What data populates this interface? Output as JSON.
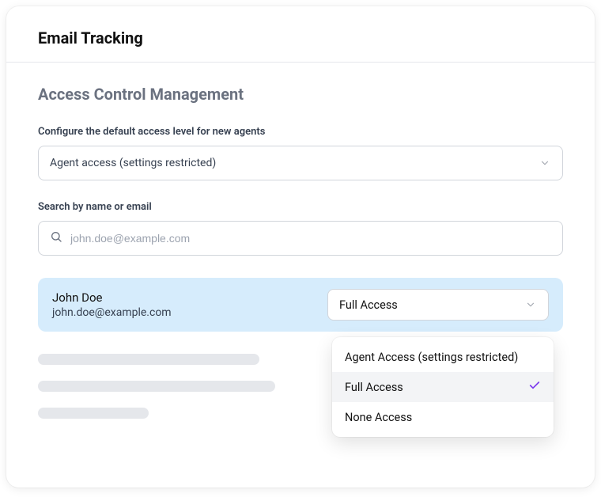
{
  "header": {
    "title": "Email Tracking"
  },
  "section": {
    "title": "Access Control Management",
    "default_access_label": "Configure the default access level for new agents",
    "default_access_value": "Agent access (settings restricted)",
    "search_label": "Search by name or email",
    "search_placeholder": "john.doe@example.com"
  },
  "user": {
    "name": "John Doe",
    "email": "john.doe@example.com",
    "access_value": "Full Access"
  },
  "dropdown": {
    "options": [
      {
        "label": "Agent Access  (settings restricted)",
        "selected": false
      },
      {
        "label": "Full Access",
        "selected": true
      },
      {
        "label": "None Access",
        "selected": false
      }
    ]
  }
}
